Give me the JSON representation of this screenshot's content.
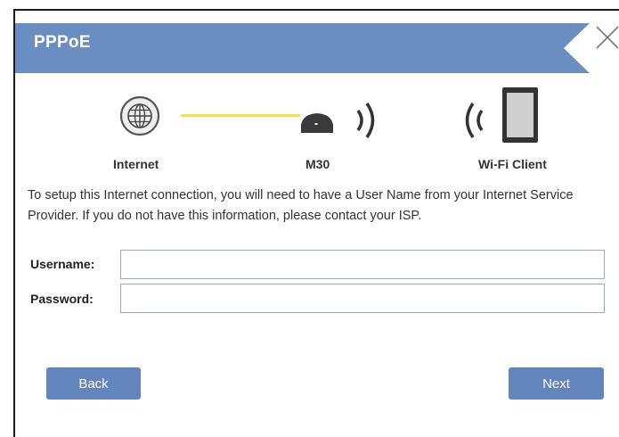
{
  "dialog": {
    "title": "PPPoE"
  },
  "diagram": {
    "internet_label": "Internet",
    "router_label": "M30",
    "client_label": "Wi-Fi Client",
    "link_color": "#f0e445"
  },
  "description": "To setup this Internet connection, you will need to have a User Name from your Internet Service Provider. If you do not have this information, please contact your ISP.",
  "form": {
    "username_label": "Username:",
    "username_value": "",
    "password_label": "Password:",
    "password_value": ""
  },
  "buttons": {
    "back_label": "Back",
    "next_label": "Next"
  },
  "colors": {
    "banner": "#6a8ec2",
    "button": "#6285be",
    "input_border": "#97aac6"
  }
}
